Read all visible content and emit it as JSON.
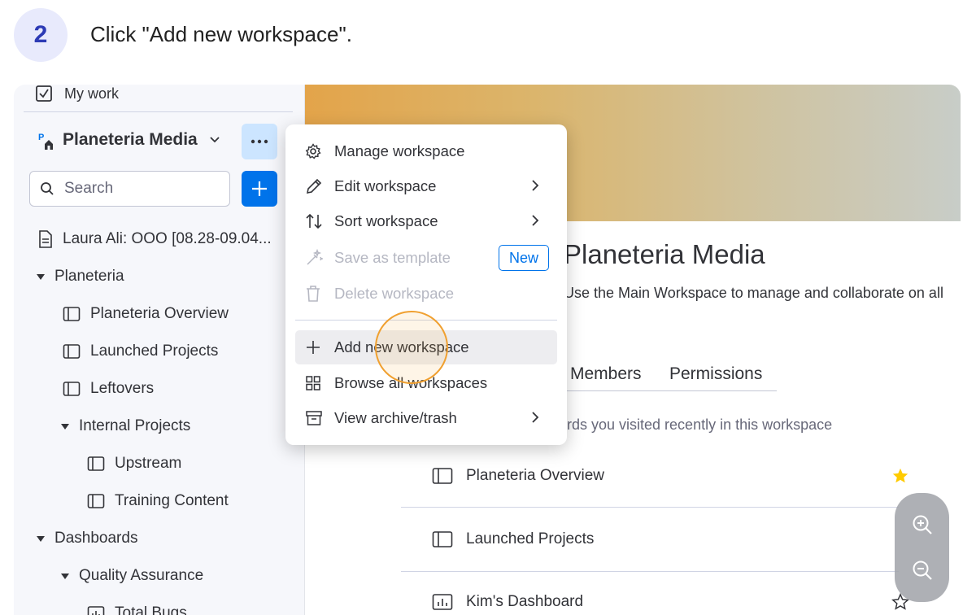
{
  "step": {
    "number": "2",
    "instruction": "Click \"Add new workspace\"."
  },
  "sidebar": {
    "my_work": "My work",
    "workspace_name": "Planeteria Media",
    "search_placeholder": "Search",
    "tree": [
      {
        "label": "Laura Ali: OOO [08.28-09.04...",
        "icon": "document-icon"
      },
      {
        "label": "Planeteria",
        "icon": "caret-down-icon"
      },
      {
        "label": "Planeteria Overview",
        "icon": "board-icon"
      },
      {
        "label": "Launched Projects",
        "icon": "board-icon"
      },
      {
        "label": "Leftovers",
        "icon": "board-icon"
      },
      {
        "label": "Internal Projects",
        "icon": "caret-down-icon"
      },
      {
        "label": "Upstream",
        "icon": "board-icon"
      },
      {
        "label": "Training Content",
        "icon": "board-icon"
      },
      {
        "label": "Dashboards",
        "icon": "caret-down-icon"
      },
      {
        "label": "Quality Assurance",
        "icon": "caret-down-icon"
      },
      {
        "label": "Total Bugs",
        "icon": "dashboard-icon"
      }
    ]
  },
  "menu": {
    "items": [
      {
        "label": "Manage workspace",
        "icon": "gear-icon",
        "disabled": false
      },
      {
        "label": "Edit workspace",
        "icon": "pencil-icon",
        "disabled": false
      },
      {
        "label": "Sort workspace",
        "icon": "sort-icon",
        "disabled": false
      },
      {
        "label": "Save as template",
        "icon": "magic-wand-icon",
        "disabled": true,
        "badge": "New"
      },
      {
        "label": "Delete workspace",
        "icon": "trash-icon",
        "disabled": true
      },
      {
        "label": "Add new workspace",
        "icon": "plus-icon",
        "disabled": false,
        "highlighted": true
      },
      {
        "label": "Browse all workspaces",
        "icon": "grid-icon",
        "disabled": false
      },
      {
        "label": "View archive/trash",
        "icon": "archive-icon",
        "disabled": false
      }
    ]
  },
  "main": {
    "title": "Planeteria Media",
    "description": "Use the Main Workspace to manage and collaborate on all",
    "tabs": [
      "Members",
      "Permissions"
    ],
    "recent_hint": "rds you visited recently in this workspace",
    "boards": [
      {
        "label": "Planeteria Overview",
        "starred": true
      },
      {
        "label": "Launched Projects",
        "starred": false
      },
      {
        "label": "Kim's Dashboard",
        "starred": false
      }
    ]
  },
  "colors": {
    "accent": "#0073ea",
    "star": "#ffcb00",
    "cursor_ring": "#f0a030",
    "banner_start": "#e3a44a"
  }
}
